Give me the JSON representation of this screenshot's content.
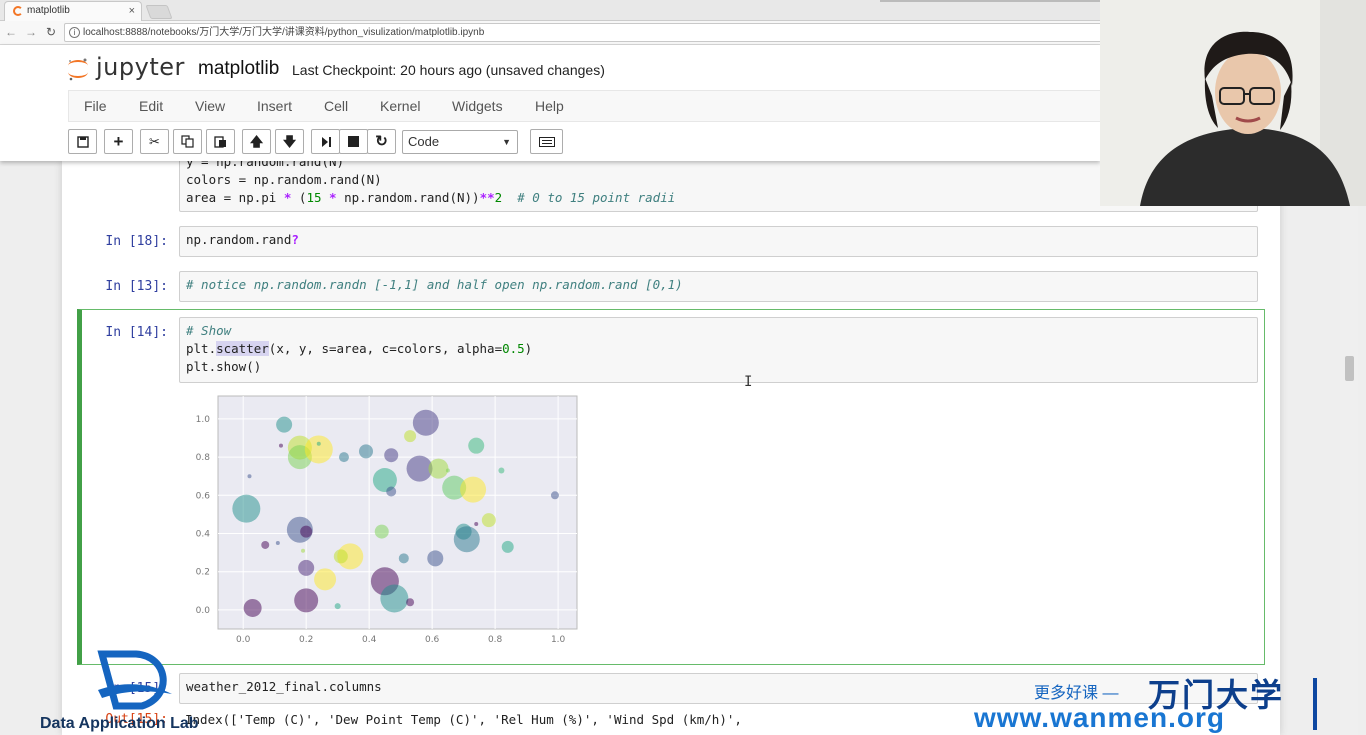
{
  "browser": {
    "tab_title": "matplotlib",
    "tab_close": "×",
    "url": "localhost:8888/notebooks/万门大学/万门大学/讲课资料/python_visulization/matplotlib.ipynb"
  },
  "jupyter": {
    "logo_text": "jupyter",
    "notebook_name": "matplotlib",
    "checkpoint": "Last Checkpoint: 20 hours ago (unsaved changes)",
    "menu": [
      "File",
      "Edit",
      "View",
      "Insert",
      "Cell",
      "Kernel",
      "Widgets",
      "Help"
    ],
    "toolbar": {
      "icons": [
        "save-icon",
        "plus-icon",
        "cut-icon",
        "copy-icon",
        "paste-icon",
        "arrow-up-icon",
        "arrow-down-icon",
        "run-icon",
        "stop-icon",
        "restart-icon"
      ],
      "cell_type": "Code",
      "keyboard_icon": "keyboard-icon"
    }
  },
  "cells": {
    "c0": {
      "line1_a": "y = np.random.rand(N)",
      "line2": "colors = np.random.rand(N)",
      "line3_a": "area = np.pi ",
      "line3_op1": "*",
      "line3_b": " (",
      "line3_n1": "15",
      "line3_c": " ",
      "line3_op2": "*",
      "line3_d": " np.random.rand(N))",
      "line3_op3": "**",
      "line3_n2": "2",
      "line3_e": "  ",
      "line3_comment": "# 0 to 15 point radii"
    },
    "c1": {
      "prompt": "In  [18]:",
      "code_a": "np.random.rand",
      "code_q": "?"
    },
    "c2": {
      "prompt": "In  [13]:",
      "comment": "# notice np.random.randn [-1,1] and half open np.random.rand [0,1)"
    },
    "c3": {
      "prompt": "In  [14]:",
      "line1": "# Show",
      "line2_a": "plt.",
      "line2_hl": "scatter",
      "line2_b": "(x, y, s=area, c=colors, alpha=",
      "line2_num": "0.5",
      "line2_c": ")",
      "line3": "plt.show()"
    },
    "c4": {
      "prompt": "In  [15]:",
      "code": "weather_2012_final.columns"
    },
    "out4": {
      "prompt": "Out[15]:",
      "line1": "Index(['Temp (C)', 'Dew Point Temp (C)', 'Rel Hum (%)', 'Wind Spd (km/h)',"
    }
  },
  "cursor": "I",
  "watermarks": {
    "left_text": "Data Application Lab",
    "right_cn": "更多好课 —",
    "right_brand": "万门大学",
    "right_url": "www.wanmen.org"
  },
  "chart_data": {
    "type": "scatter",
    "title": "",
    "xlabel": "",
    "ylabel": "",
    "xlim": [
      -0.08,
      1.06
    ],
    "ylim": [
      -0.1,
      1.12
    ],
    "x_ticks": [
      "0.0",
      "0.2",
      "0.4",
      "0.6",
      "0.8",
      "1.0"
    ],
    "y_ticks": [
      "0.0",
      "0.2",
      "0.4",
      "0.6",
      "0.8",
      "1.0"
    ],
    "grid": true,
    "alpha": 0.5,
    "points": [
      {
        "x": 0.03,
        "y": 0.01,
        "r": 9,
        "color": "#440154"
      },
      {
        "x": 0.01,
        "y": 0.53,
        "r": 14,
        "color": "#21908c"
      },
      {
        "x": 0.02,
        "y": 0.7,
        "r": 2,
        "color": "#3b528b"
      },
      {
        "x": 0.07,
        "y": 0.34,
        "r": 4,
        "color": "#440154"
      },
      {
        "x": 0.11,
        "y": 0.35,
        "r": 2,
        "color": "#3b528b"
      },
      {
        "x": 0.13,
        "y": 0.97,
        "r": 8,
        "color": "#21908c"
      },
      {
        "x": 0.12,
        "y": 0.86,
        "r": 2,
        "color": "#440154"
      },
      {
        "x": 0.18,
        "y": 0.85,
        "r": 12,
        "color": "#bddf26"
      },
      {
        "x": 0.18,
        "y": 0.8,
        "r": 12,
        "color": "#7ad151"
      },
      {
        "x": 0.24,
        "y": 0.84,
        "r": 14,
        "color": "#fde725"
      },
      {
        "x": 0.24,
        "y": 0.87,
        "r": 2,
        "color": "#22a884"
      },
      {
        "x": 0.32,
        "y": 0.8,
        "r": 5,
        "color": "#2a788e"
      },
      {
        "x": 0.18,
        "y": 0.42,
        "r": 13,
        "color": "#3b528b"
      },
      {
        "x": 0.2,
        "y": 0.41,
        "r": 6,
        "color": "#440154"
      },
      {
        "x": 0.19,
        "y": 0.31,
        "r": 2,
        "color": "#a0da39"
      },
      {
        "x": 0.2,
        "y": 0.22,
        "r": 8,
        "color": "#482475"
      },
      {
        "x": 0.2,
        "y": 0.05,
        "r": 12,
        "color": "#440154"
      },
      {
        "x": 0.26,
        "y": 0.16,
        "r": 11,
        "color": "#fde725"
      },
      {
        "x": 0.3,
        "y": 0.02,
        "r": 3,
        "color": "#22a884"
      },
      {
        "x": 0.34,
        "y": 0.28,
        "r": 13,
        "color": "#fde725"
      },
      {
        "x": 0.31,
        "y": 0.28,
        "r": 7,
        "color": "#bddf26"
      },
      {
        "x": 0.39,
        "y": 0.83,
        "r": 7,
        "color": "#2a788e"
      },
      {
        "x": 0.44,
        "y": 0.41,
        "r": 7,
        "color": "#7ad151"
      },
      {
        "x": 0.45,
        "y": 0.68,
        "r": 12,
        "color": "#22a884"
      },
      {
        "x": 0.47,
        "y": 0.62,
        "r": 5,
        "color": "#3b528b"
      },
      {
        "x": 0.47,
        "y": 0.81,
        "r": 7,
        "color": "#443983"
      },
      {
        "x": 0.45,
        "y": 0.15,
        "r": 14,
        "color": "#440154"
      },
      {
        "x": 0.48,
        "y": 0.06,
        "r": 14,
        "color": "#21908c"
      },
      {
        "x": 0.51,
        "y": 0.27,
        "r": 5,
        "color": "#2a788e"
      },
      {
        "x": 0.53,
        "y": 0.04,
        "r": 4,
        "color": "#440154"
      },
      {
        "x": 0.53,
        "y": 0.91,
        "r": 6,
        "color": "#bddf26"
      },
      {
        "x": 0.56,
        "y": 0.74,
        "r": 13,
        "color": "#443983"
      },
      {
        "x": 0.58,
        "y": 0.98,
        "r": 13,
        "color": "#443983"
      },
      {
        "x": 0.61,
        "y": 0.27,
        "r": 8,
        "color": "#3b528b"
      },
      {
        "x": 0.62,
        "y": 0.74,
        "r": 10,
        "color": "#a0da39"
      },
      {
        "x": 0.67,
        "y": 0.64,
        "r": 12,
        "color": "#5ec962"
      },
      {
        "x": 0.65,
        "y": 0.73,
        "r": 2,
        "color": "#7ad151"
      },
      {
        "x": 0.7,
        "y": 0.41,
        "r": 8,
        "color": "#21908c"
      },
      {
        "x": 0.71,
        "y": 0.37,
        "r": 13,
        "color": "#2a788e"
      },
      {
        "x": 0.73,
        "y": 0.63,
        "r": 13,
        "color": "#fde725"
      },
      {
        "x": 0.74,
        "y": 0.86,
        "r": 8,
        "color": "#35b779"
      },
      {
        "x": 0.74,
        "y": 0.45,
        "r": 2,
        "color": "#440154"
      },
      {
        "x": 0.78,
        "y": 0.47,
        "r": 7,
        "color": "#bddf26"
      },
      {
        "x": 0.82,
        "y": 0.73,
        "r": 3,
        "color": "#35b779"
      },
      {
        "x": 0.84,
        "y": 0.33,
        "r": 6,
        "color": "#22a884"
      },
      {
        "x": 0.99,
        "y": 0.6,
        "r": 4,
        "color": "#3b528b"
      }
    ]
  }
}
